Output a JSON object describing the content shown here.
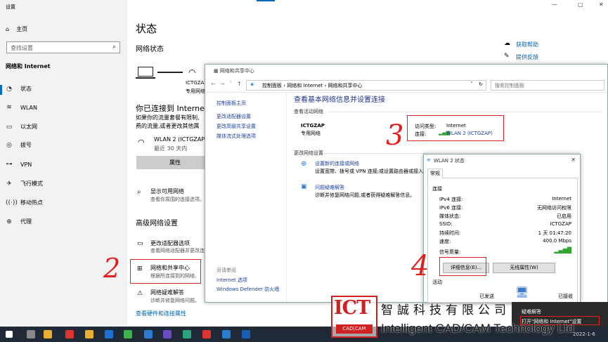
{
  "settings": {
    "window_title": "设置",
    "home": "主页",
    "search_placeholder": "查找设置",
    "section": "网络和 Internet",
    "nav": [
      "状态",
      "WLAN",
      "以太网",
      "拨号",
      "VPN",
      "飞行模式",
      "移动热点",
      "代理"
    ],
    "page_title": "状态",
    "network_status": "网络状态",
    "ssid_short": "ICTGZAP",
    "private_net": "专用网络",
    "connected_title": "你已连接到 Internet",
    "connected_desc_1": "如果你的流量套餐有限制,",
    "connected_desc_2": "费的流量,或者更改其他属",
    "wlan_name": "WLAN 2 (ICTGZAP)",
    "wlan_recent": "最近 30 天内",
    "properties_btn": "属性",
    "show_available": "显示可用网络",
    "show_available_desc": "查看你周围的连接选项。",
    "advanced_title": "高级网络设置",
    "change_adapter": "更改适配器选项",
    "change_adapter_desc": "查看网络适配器并更改连接",
    "net_sharing_center": "网络和共享中心",
    "net_sharing_desc": "根据所连接到的网络,",
    "troubleshoot": "网络疑难解答",
    "troubleshoot_desc": "诊断并修复网络问题。",
    "hw_props_link": "查看硬件和连接属性",
    "help": "获取帮助",
    "feedback": "提供反馈"
  },
  "netcenter": {
    "window_title": "网络和共享中心",
    "breadcrumb": "控制面板 › 网络和 Internet › 网络和共享中心",
    "search_placeholder": "搜索控制面板",
    "left_links": [
      "控制面板主页",
      "更改适配器设置",
      "更改高级共享设置",
      "媒体流式处理选项"
    ],
    "see_also": "另请参阅",
    "see_also_links": [
      "Internet 选项",
      "Windows Defender 防火墙"
    ],
    "main_title": "查看基本网络信息并设置连接",
    "active_networks": "查看活动网络",
    "net_name": "ICTGZAP",
    "net_type": "专用网络",
    "access_type_label": "访问类型:",
    "access_type_value": "Internet",
    "connection_label": "连接:",
    "connection_value": "WLAN 2 (ICTGZAP)",
    "change_settings": "更改网络设置",
    "setup_new": "设置新的连接或网络",
    "setup_new_desc": "设置宽带、拨号或 VPN 连接;或设置路由器或接入点。",
    "troubleshoot": "问题疑难解答",
    "troubleshoot_desc": "诊断并修复网络问题,或者获得疑难解答信息。"
  },
  "wlan_status": {
    "window_title": "WLAN 2 状态",
    "tab": "常规",
    "connection_section": "连接",
    "rows": [
      {
        "label": "IPv4 连接:",
        "value": "Internet"
      },
      {
        "label": "IPv6 连接:",
        "value": "无网络访问权限"
      },
      {
        "label": "媒体状态:",
        "value": "已启用"
      },
      {
        "label": "SSID:",
        "value": "ICTGZAP"
      },
      {
        "label": "持续时间:",
        "value": "1 天 01:47:20"
      },
      {
        "label": "速度:",
        "value": "400.0 Mbps"
      }
    ],
    "signal_quality": "信号质量:",
    "details_btn": "详细信息(E)...",
    "wireless_props_btn": "无线属性(W)",
    "activity": "活动",
    "sent": "已发送",
    "received": "已接收"
  },
  "context_menu": {
    "items": [
      "疑难解答",
      "打开\"网络和 Internet\"设置"
    ]
  },
  "taskbar": {
    "date": "2022-1-6"
  },
  "annotations": [
    "2",
    "3",
    "4"
  ],
  "watermark": {
    "logo_text": "ICT",
    "logo_sub": "CAD|CAM",
    "cn": "智誠科技有限公司",
    "en": "Intelligent CAD/CAM Technology Ltd"
  },
  "colors": {
    "accent": "#0067c0",
    "annotation_red": "#e02020",
    "taskbar": "#1f2a36",
    "signal_green": "#2fa52f"
  }
}
